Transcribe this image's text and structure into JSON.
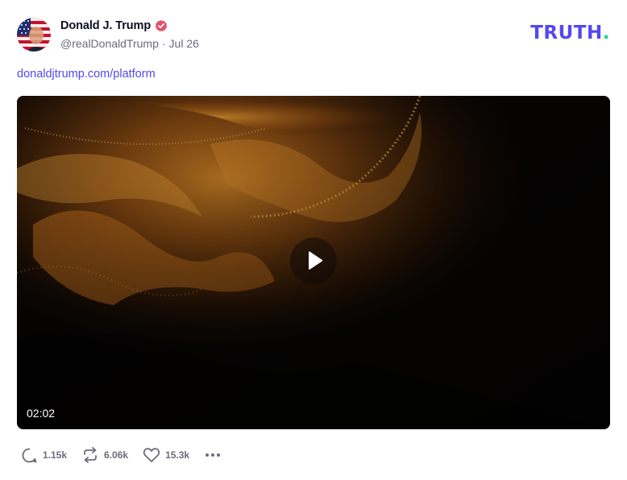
{
  "post": {
    "author": {
      "display_name": "Donald J. Trump",
      "handle": "@realDonaldTrump",
      "date": "Jul 26",
      "separator": "·",
      "verified": true
    },
    "brand": {
      "logo_text": "TRUTH",
      "logo_dot": ".",
      "color": "#5448ee",
      "dot_color": "#19d4a0"
    },
    "link_text": "donaldjtrump.com/platform",
    "video": {
      "duration": "02:02",
      "play_icon": "play-icon"
    },
    "actions": {
      "replies": "1.15k",
      "retruths": "6.06k",
      "likes": "15.3k",
      "reply_icon": "reply-icon",
      "retruth_icon": "retruth-icon",
      "like_icon": "heart-icon",
      "more_icon": "more-icon"
    }
  }
}
